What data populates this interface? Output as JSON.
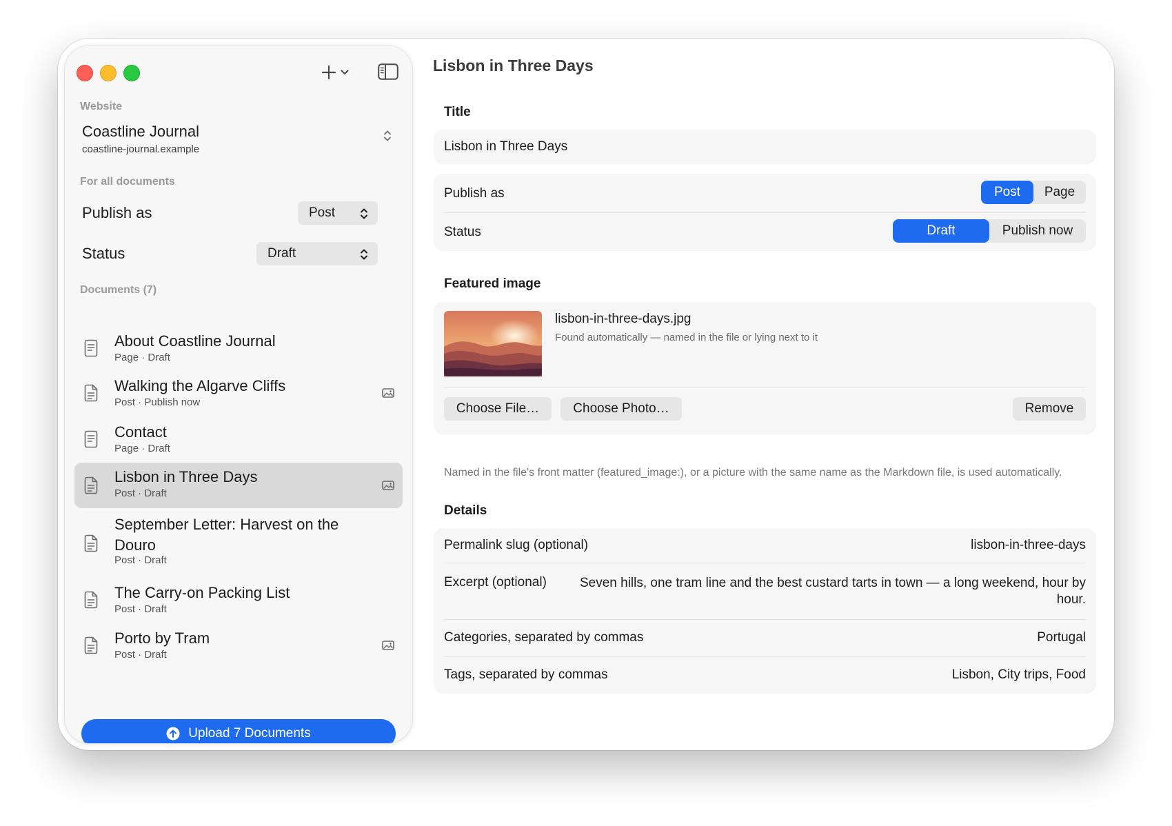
{
  "window": {
    "title": "Lisbon in Three Days"
  },
  "sidebar": {
    "website_label": "Website",
    "site_name": "Coastline Journal",
    "site_url": "coastline-journal.example",
    "for_all_label": "For all documents",
    "publish_as": {
      "label": "Publish as",
      "value": "Post"
    },
    "status": {
      "label": "Status",
      "value": "Draft"
    },
    "documents_label": "Documents (7)",
    "documents": [
      {
        "title": "About Coastline Journal",
        "meta": "Page · Draft",
        "has_image": false,
        "kind": "page"
      },
      {
        "title": "Walking the Algarve Cliffs",
        "meta": "Post · Publish now",
        "has_image": true,
        "kind": "post"
      },
      {
        "title": "Contact",
        "meta": "Page · Draft",
        "has_image": false,
        "kind": "page"
      },
      {
        "title": "Lisbon in Three Days",
        "meta": "Post · Draft",
        "has_image": true,
        "kind": "post",
        "selected": true
      },
      {
        "title": "September Letter: Harvest on the Douro",
        "meta": "Post · Draft",
        "has_image": false,
        "kind": "post"
      },
      {
        "title": "The Carry-on Packing List",
        "meta": "Post · Draft",
        "has_image": false,
        "kind": "post"
      },
      {
        "title": "Porto by Tram",
        "meta": "Post · Draft",
        "has_image": true,
        "kind": "post"
      }
    ],
    "upload_label": "Upload 7 Documents"
  },
  "main": {
    "title_section": "Title",
    "title_value": "Lisbon in Three Days",
    "publish_as": {
      "label": "Publish as",
      "options": [
        "Post",
        "Page"
      ],
      "selected": "Post"
    },
    "status": {
      "label": "Status",
      "options": [
        "Draft",
        "Publish now"
      ],
      "selected": "Draft"
    },
    "featured_section": "Featured image",
    "image_filename": "lisbon-in-three-days.jpg",
    "image_note": "Found automatically — named in the file or lying next to it",
    "choose_file": "Choose File…",
    "choose_photo": "Choose Photo…",
    "remove": "Remove",
    "hint": "Named in the file's front matter (featured_image:), or a picture with the same name as the Markdown file, is used automatically.",
    "details_section": "Details",
    "details": {
      "slug_label": "Permalink slug (optional)",
      "slug_value": "lisbon-in-three-days",
      "excerpt_label": "Excerpt (optional)",
      "excerpt_value": "Seven hills, one tram line and the best custard tarts in town — a long weekend, hour by hour.",
      "categories_label": "Categories, separated by commas",
      "categories_value": "Portugal",
      "tags_label": "Tags, separated by commas",
      "tags_value": "Lisbon, City trips, Food"
    }
  },
  "colors": {
    "accent": "#1f6bf0",
    "selection": "#d9d9d9"
  }
}
